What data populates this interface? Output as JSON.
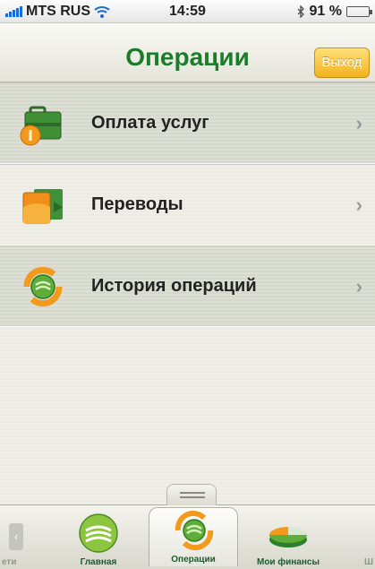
{
  "status_bar": {
    "carrier": "MTS RUS",
    "time": "14:59",
    "battery": "91 %",
    "battery_level": 0.91,
    "icons": [
      "signal-icon",
      "wifi-icon",
      "bluetooth-icon",
      "battery-icon"
    ]
  },
  "navbar": {
    "title": "Операции",
    "exit_label": "Выход"
  },
  "list": {
    "items": [
      {
        "label": "Оплата услуг",
        "icon": "briefcase-icon",
        "chevron": "›"
      },
      {
        "label": "Переводы",
        "icon": "folder-transfer-icon",
        "chevron": "›"
      },
      {
        "label": "История операций",
        "icon": "history-cycle-icon",
        "chevron": "›"
      }
    ]
  },
  "tabbar": {
    "left_partial": "ети",
    "right_partial": "Ш",
    "tabs": [
      {
        "label": "Главная",
        "icon": "sberbank-logo-icon"
      },
      {
        "label": "Операции",
        "icon": "operations-cycle-icon",
        "active": true
      },
      {
        "label": "Мои финансы",
        "icon": "pie-chart-icon"
      }
    ]
  },
  "colors": {
    "title_green": "#1c7c2c",
    "exit_button": "#f2b21e",
    "accent_orange": "#f39a1c"
  }
}
